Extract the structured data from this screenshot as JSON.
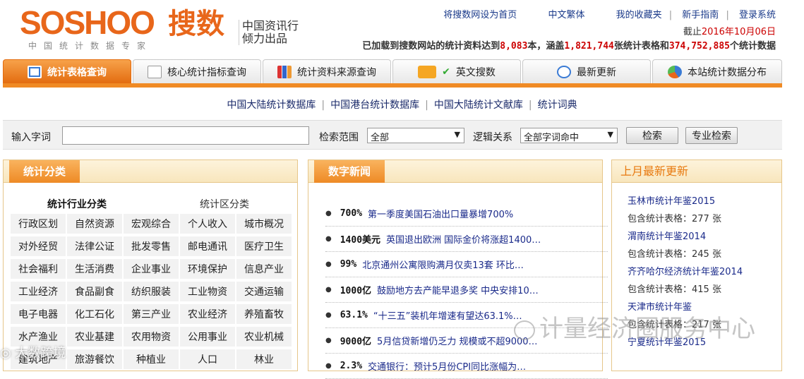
{
  "header": {
    "logo_word": "SOSHOO",
    "logo_cn": "搜数",
    "logo_sub": "中国统计数据专家",
    "tagline": "中国资讯行 倾力出品",
    "toplinks": [
      "将搜数网设为首页",
      "中文繁体",
      "我的收藏夹",
      "新手指南",
      "登录系统"
    ],
    "date_prefix": "截止",
    "date_value": "2016年10月06日",
    "stats": {
      "p1": "已加载到搜数网站的统计资料达到",
      "n1": "8,083",
      "p2": "本，涵盖",
      "n2": "1,821,744",
      "p3": "张统计表格和",
      "n3": "374,752,885",
      "p4": "个统计数据"
    }
  },
  "tabs": [
    {
      "label": "统计表格查询",
      "icon": "table-icon",
      "active": true
    },
    {
      "label": "核心统计指标查询",
      "icon": "document-icon",
      "active": false
    },
    {
      "label": "统计资料来源查询",
      "icon": "bar-chart-icon",
      "active": false
    },
    {
      "label": "英文搜数",
      "icon": "new-check-icon",
      "active": false
    },
    {
      "label": "最新更新",
      "icon": "clock-icon",
      "active": false
    },
    {
      "label": "本站统计数据分布",
      "icon": "pie-chart-icon",
      "active": false
    }
  ],
  "sublinks": [
    "中国大陆统计数据库",
    "中国港台统计数据库",
    "中国大陆统计文献库",
    "统计词典"
  ],
  "search": {
    "input_label": "输入字词",
    "input_value": "",
    "scope_label": "检索范围",
    "scope_value": "全部",
    "logic_label": "逻辑关系",
    "logic_value": "全部字词命中",
    "search_button": "检索",
    "advanced_button": "专业检索"
  },
  "categories": {
    "title": "统计分类",
    "industry_head": "统计行业分类",
    "region_head": "统计区分类",
    "items": [
      "行政区划",
      "自然资源",
      "宏观综合",
      "个人收入",
      "城市概况",
      "对外经贸",
      "法律公证",
      "批发零售",
      "邮电通讯",
      "医疗卫生",
      "社会福利",
      "生活消费",
      "企业事业",
      "环境保护",
      "信息产业",
      "工业经济",
      "食品副食",
      "纺织服装",
      "工业物资",
      "交通运输",
      "电子电器",
      "化工石化",
      "第三产业",
      "农业经济",
      "养殖畜牧",
      "水产渔业",
      "农业基建",
      "农用物资",
      "公用事业",
      "农业机械",
      "建筑地产",
      "旅游餐饮",
      "种植业",
      "人口",
      "林业"
    ]
  },
  "news": {
    "title": "数字新闻",
    "items": [
      {
        "num": "700%",
        "text": "第一季度美国石油出口量暴增700%"
      },
      {
        "num": "1400美元",
        "text": "英国退出欧洲 国际金价将涨超1400…"
      },
      {
        "num": "99%",
        "text": "北京通州公寓限购满月仅卖13套 环比…"
      },
      {
        "num": "1000亿",
        "text": "鼓励地方去产能早退多奖 中央安排10…"
      },
      {
        "num": "63.1%",
        "text": "“十三五”装机年增速有望达63.1%…"
      },
      {
        "num": "9000亿",
        "text": "5月信贷新增仍乏力 规模或不超9000…"
      },
      {
        "num": "2.3%",
        "text": "交通银行：预计5月份CPI同比涨幅为…"
      }
    ]
  },
  "updates": {
    "title": "上月最新更新",
    "items": [
      {
        "title": "玉林市统计年鉴2015",
        "count": "包含统计表格：277 张"
      },
      {
        "title": "渭南统计年鉴2014",
        "count": "包含统计表格：245 张"
      },
      {
        "title": "齐齐哈尔经济统计年鉴2014",
        "count": "包含统计表格：415 张"
      },
      {
        "title": "天津市统计年鉴",
        "count": "包含统计表格：217 张"
      },
      {
        "title": "宁夏统计年鉴2015",
        "count": ""
      }
    ]
  },
  "watermarks": {
    "wechat": "计量经济圈服务中心",
    "weibo": "大数跨境"
  },
  "colors": {
    "brand_orange": "#e8661a",
    "tab_orange": "#f08a24",
    "link_blue": "#1a2a8a",
    "highlight_red": "#cc0000"
  }
}
